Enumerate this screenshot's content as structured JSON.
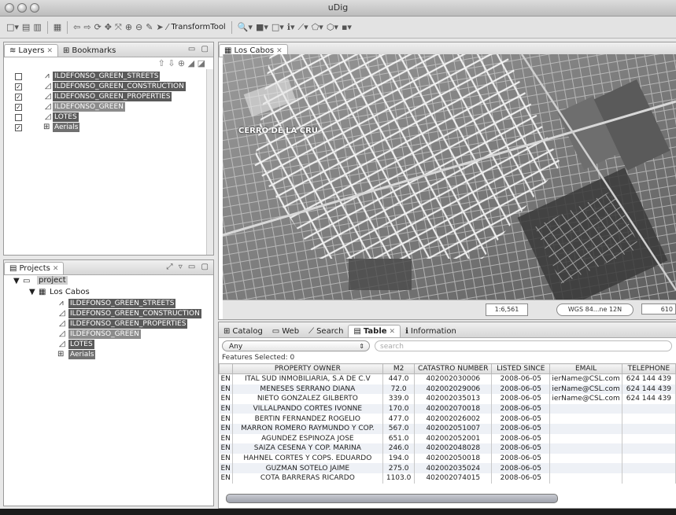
{
  "window": {
    "title": "uDig"
  },
  "toolbar": {
    "transform_tool_label": "TransformTool"
  },
  "layers_panel": {
    "tabs": [
      {
        "label": "Layers"
      },
      {
        "label": "Bookmarks"
      }
    ],
    "layers": [
      {
        "name": "ILDEFONSO_GREEN_STREETS",
        "checked": false,
        "highlight": true
      },
      {
        "name": "ILDEFONSO_GREEN_CONSTRUCTION",
        "checked": true,
        "highlight": true
      },
      {
        "name": "ILDEFONSO_GREEN_PROPERTIES",
        "checked": true,
        "highlight": true
      },
      {
        "name": "ILDEFONSO_GREEN",
        "checked": true,
        "highlight": true
      },
      {
        "name": "LOTES",
        "checked": false,
        "highlight": true
      },
      {
        "name": "Aerials",
        "checked": true,
        "highlight": true
      }
    ]
  },
  "projects_panel": {
    "tab_label": "Projects",
    "project_name": "project",
    "map_name": "Los Cabos",
    "layers": [
      "ILDEFONSO_GREEN_STREETS",
      "ILDEFONSO_GREEN_CONSTRUCTION",
      "ILDEFONSO_GREEN_PROPERTIES",
      "ILDEFONSO_GREEN",
      "LOTES",
      "Aerials"
    ]
  },
  "map_editor": {
    "tab_label": "Los Cabos",
    "labels": [
      "CERRO DE LA CRU"
    ],
    "scale": "1:6,561",
    "crs": "WGS 84...ne 12N",
    "coord": "610"
  },
  "bottom_panel": {
    "tabs": [
      {
        "label": "Catalog"
      },
      {
        "label": "Web"
      },
      {
        "label": "Search"
      },
      {
        "label": "Table",
        "active": true
      },
      {
        "label": "Information"
      }
    ],
    "filter_value": "Any",
    "search_placeholder": "search",
    "features_selected": "Features Selected: 0",
    "columns": [
      "",
      "PROPERTY OWNER",
      "M2",
      "CATASTRO NUMBER",
      "LISTED SINCE",
      "EMAIL",
      "TELEPHONE"
    ],
    "rows": [
      [
        "EN",
        "ITAL SUD INMOBILIARIA, S.A DE C.V",
        "447.0",
        "402002030006",
        "2008-06-05",
        "ierName@CSL.com",
        "624 144 439"
      ],
      [
        "EN",
        "MENESES SERRANO DIANA",
        "72.0",
        "402002029006",
        "2008-06-05",
        "ierName@CSL.com",
        "624 144 439"
      ],
      [
        "EN",
        "NIETO GONZALEZ GILBERTO",
        "339.0",
        "402002035013",
        "2008-06-05",
        "ierName@CSL.com",
        "624 144 439"
      ],
      [
        "EN",
        "VILLALPANDO CORTES IVONNE",
        "170.0",
        "402002070018",
        "2008-06-05",
        "",
        ""
      ],
      [
        "EN",
        "BERTIN FERNANDEZ ROGELIO",
        "477.0",
        "402002026002",
        "2008-06-05",
        "",
        ""
      ],
      [
        "EN",
        "MARRON ROMERO RAYMUNDO Y COP.",
        "567.0",
        "402002051007",
        "2008-06-05",
        "",
        ""
      ],
      [
        "EN",
        "AGUNDEZ ESPINOZA JOSE",
        "651.0",
        "402002052001",
        "2008-06-05",
        "",
        ""
      ],
      [
        "EN",
        "SAIZA CESENA Y COP. MARINA",
        "246.0",
        "402002048028",
        "2008-06-05",
        "",
        ""
      ],
      [
        "EN",
        "HAHNEL CORTES Y COPS. EDUARDO",
        "194.0",
        "402002050018",
        "2008-06-05",
        "",
        ""
      ],
      [
        "EN",
        "GUZMAN SOTELO JAIME",
        "275.0",
        "402002035024",
        "2008-06-05",
        "",
        ""
      ],
      [
        "EN",
        "COTA BARRERAS RICARDO",
        "1103.0",
        "402002074015",
        "2008-06-05",
        "",
        ""
      ]
    ]
  }
}
